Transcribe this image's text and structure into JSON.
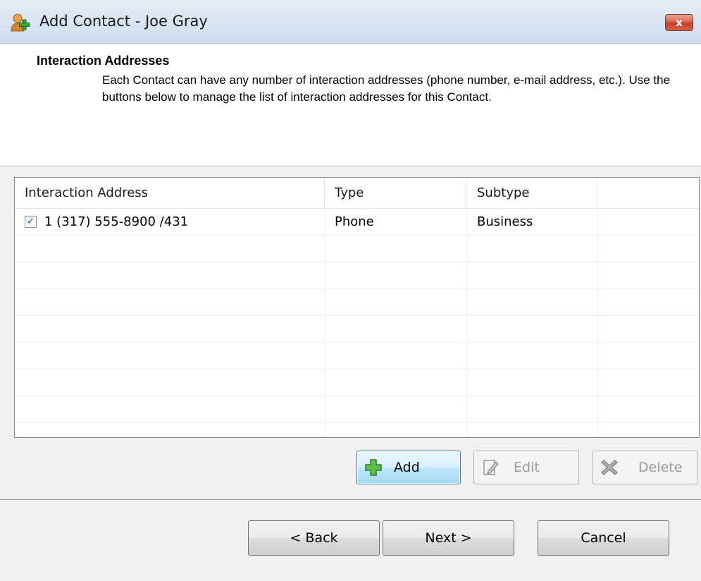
{
  "window": {
    "title": "Add Contact - Joe Gray",
    "close_label": "x"
  },
  "header": {
    "title": "Interaction Addresses",
    "description": "Each Contact can have any number of interaction addresses (phone number, e-mail address, etc.).  Use the buttons below to manage the list of interaction addresses for this Contact."
  },
  "list": {
    "columns": [
      "Interaction Address",
      "Type",
      "Subtype"
    ],
    "rows": [
      {
        "checked": true,
        "address": "1 (317) 555-8900 /431",
        "type": "Phone",
        "subtype": "Business"
      }
    ]
  },
  "actions": {
    "add_label": "Add",
    "edit_label": "Edit",
    "delete_label": "Delete"
  },
  "nav": {
    "back_label": "< Back",
    "next_label": "Next >",
    "cancel_label": "Cancel"
  }
}
